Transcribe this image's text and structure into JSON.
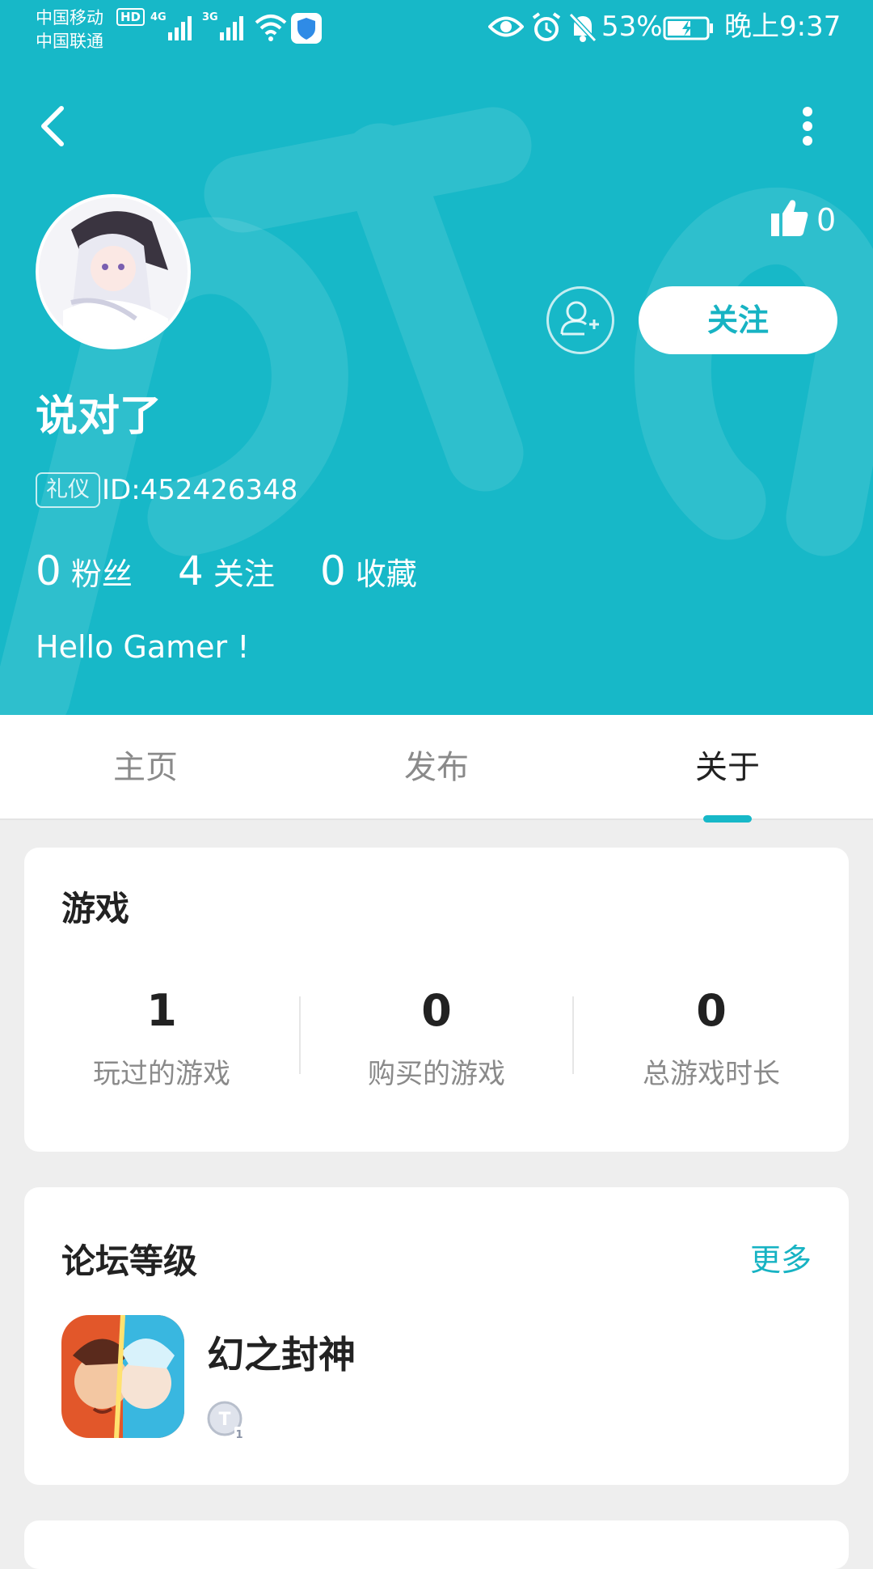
{
  "status_bar": {
    "carrier_1": "中国移动",
    "carrier_2": "中国联通",
    "hd": "HD",
    "net_1": "4G",
    "net_2": "3G",
    "battery": "53%",
    "time": "晚上9:37"
  },
  "profile": {
    "username": "说对了",
    "badge": "礼仪",
    "user_id": "ID:452426348",
    "likes": "0",
    "follow_label": "关注",
    "stats": [
      {
        "value": "0",
        "label": "粉丝"
      },
      {
        "value": "4",
        "label": "关注"
      },
      {
        "value": "0",
        "label": "收藏"
      }
    ],
    "bio": "Hello Gamer !"
  },
  "tabs": [
    {
      "label": "主页",
      "active": false
    },
    {
      "label": "发布",
      "active": false
    },
    {
      "label": "关于",
      "active": true
    }
  ],
  "games_card": {
    "title": "游戏",
    "stats": [
      {
        "value": "1",
        "label": "玩过的游戏"
      },
      {
        "value": "0",
        "label": "购买的游戏"
      },
      {
        "value": "0",
        "label": "总游戏时长"
      }
    ]
  },
  "forum_card": {
    "title": "论坛等级",
    "more_label": "更多",
    "game_name": "幻之封神"
  },
  "colors": {
    "accent": "#17b8c8",
    "background": "#eeeeee"
  }
}
